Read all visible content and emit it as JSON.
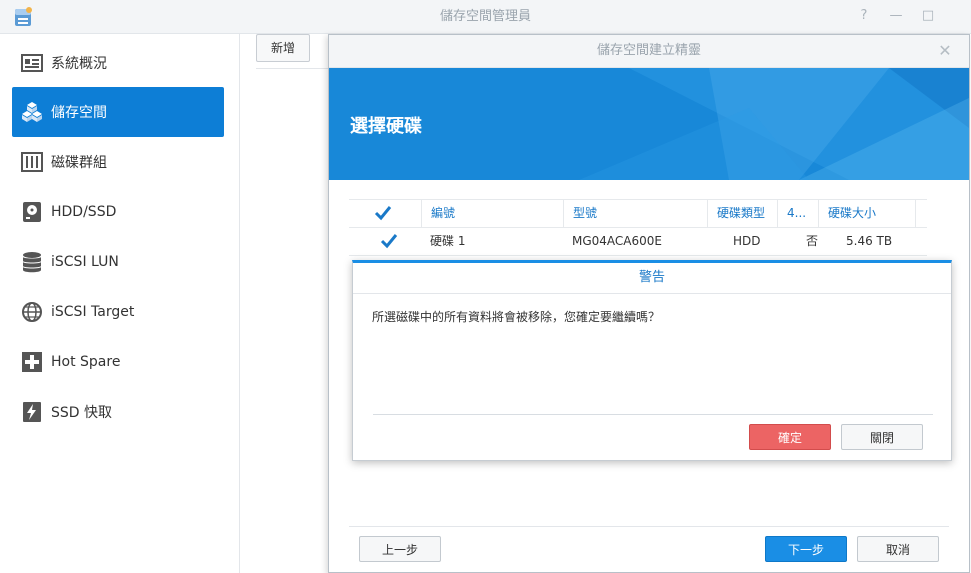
{
  "app": {
    "title": "儲存空間管理員"
  },
  "window_controls": {
    "help": "?",
    "minimize": "—",
    "maximize": "□"
  },
  "sidebar": {
    "items": [
      {
        "label": "系統概況"
      },
      {
        "label": "儲存空間"
      },
      {
        "label": "磁碟群組"
      },
      {
        "label": "HDD/SSD"
      },
      {
        "label": "iSCSI LUN"
      },
      {
        "label": "iSCSI Target"
      },
      {
        "label": "Hot Spare"
      },
      {
        "label": "SSD 快取"
      }
    ]
  },
  "toolbar": {
    "new_label": "新增"
  },
  "wizard": {
    "title": "儲存空間建立精靈",
    "close": "✕",
    "heading": "選擇硬碟",
    "table": {
      "headers": [
        "編號",
        "型號",
        "硬碟類型",
        "4...",
        "硬碟大小"
      ],
      "rows": [
        {
          "id": "硬碟 1",
          "model": "MG04ACA600E",
          "type": "HDD",
          "col4": "否",
          "size": "5.46 TB"
        }
      ]
    },
    "back_label": "上一步",
    "next_label": "下一步",
    "cancel_label": "取消"
  },
  "warning": {
    "title": "警告",
    "message": "所選磁碟中的所有資料將會被移除，您確定要繼續嗎？",
    "confirm_label": "確定",
    "close_label": "關閉"
  },
  "colors": {
    "accent": "#0d7ed6",
    "banner": "#1888d8",
    "danger": "#ec6464"
  }
}
